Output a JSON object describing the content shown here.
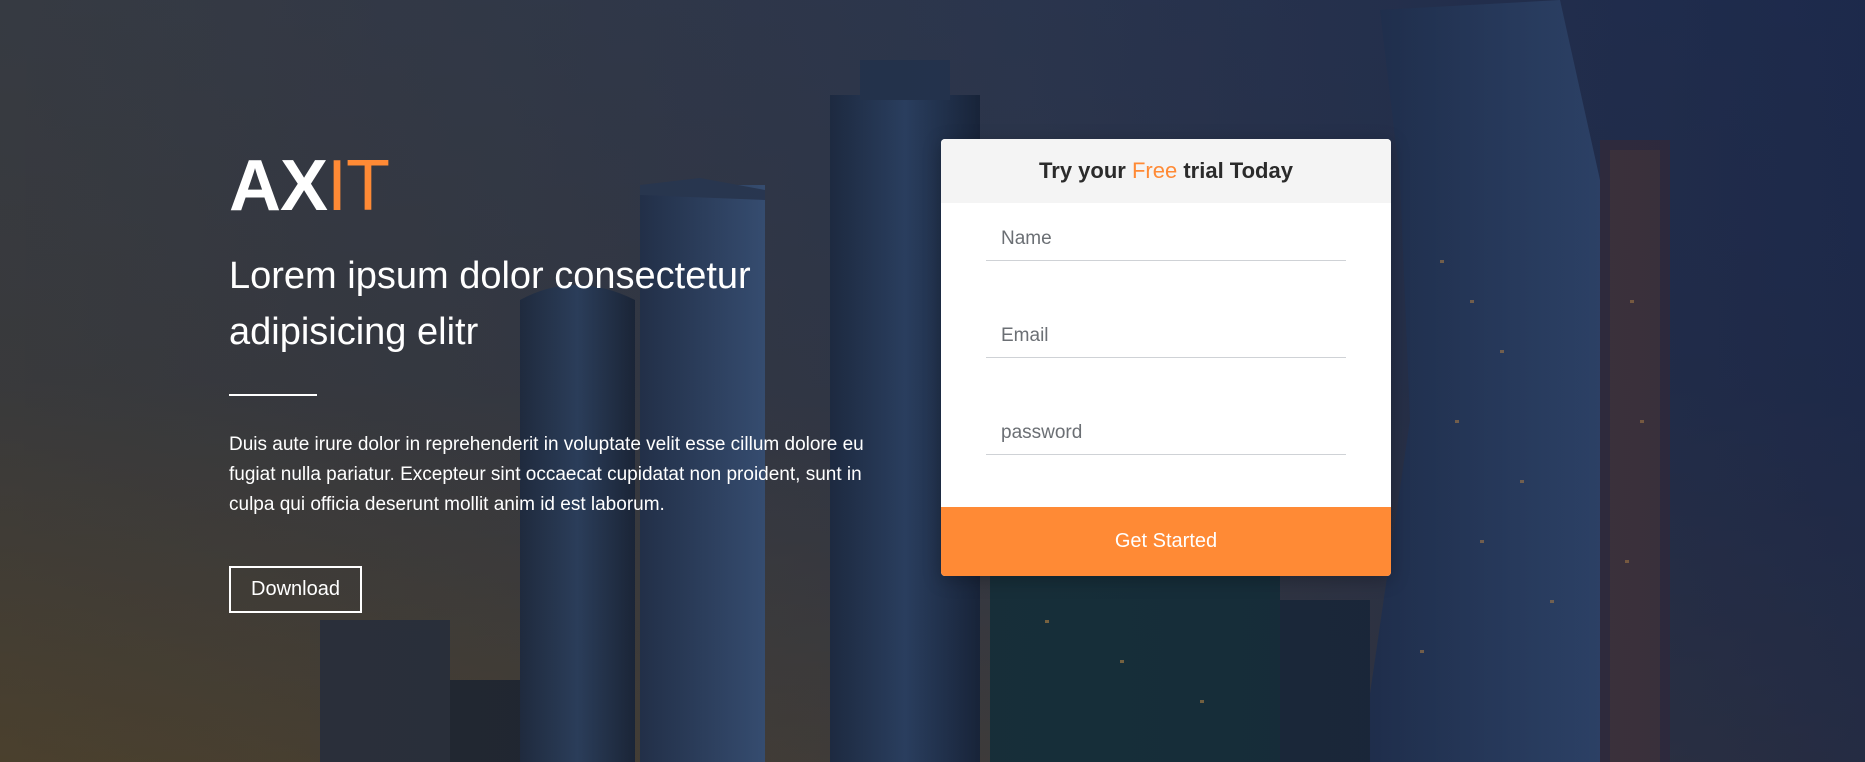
{
  "brand": {
    "primary": "AX",
    "accent": "IT"
  },
  "hero": {
    "headline_line1": "Lorem ipsum dolor consectetur",
    "headline_line2": "adipisicing elitr",
    "description": "Duis aute irure dolor in reprehenderit in voluptate velit esse cillum dolore eu fugiat nulla pariatur. Excepteur sint occaecat cupidatat non proident, sunt in culpa qui officia deserunt mollit anim id est laborum.",
    "download_label": "Download"
  },
  "form": {
    "title_before": "Try your ",
    "title_highlight": "Free",
    "title_after": " trial Today",
    "name_placeholder": "Name",
    "email_placeholder": "Email",
    "password_placeholder": "password",
    "submit_label": "Get Started"
  },
  "colors": {
    "accent": "#ff8a35",
    "header_bg": "#f4f4f4",
    "text_dark": "#2b2b2b"
  }
}
